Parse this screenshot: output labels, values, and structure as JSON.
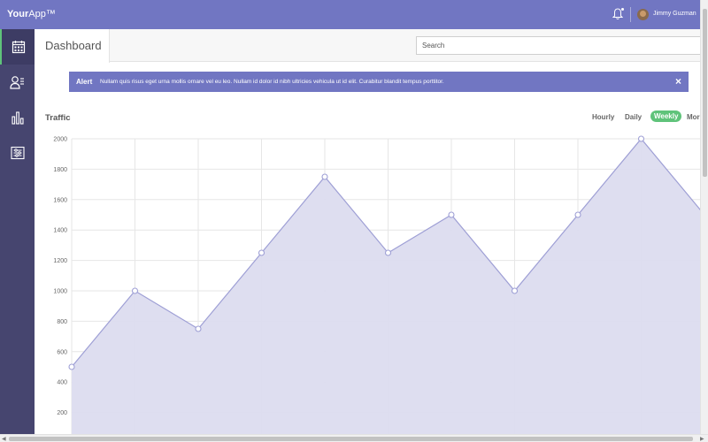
{
  "header": {
    "logo_bold": "Your",
    "logo_light": "App™",
    "username": "Jimmy Guzman"
  },
  "sidebar": {
    "items": [
      {
        "icon": "calendar-icon",
        "active": true
      },
      {
        "icon": "users-list-icon",
        "active": false
      },
      {
        "icon": "bar-chart-icon",
        "active": false
      },
      {
        "icon": "settings-sliders-icon",
        "active": false
      }
    ]
  },
  "main": {
    "tab_label": "Dashboard",
    "search_placeholder": "Search",
    "alert": {
      "title": "Alert",
      "text": "Nullam quis risus eget urna mollis ornare vel eu leo. Nullam id dolor id nibh ultricies vehicula ut id elit. Curabitur blandit tempus porttitor.",
      "close": "×"
    },
    "traffic": {
      "title": "Traffic",
      "ranges": [
        "Hourly",
        "Daily",
        "Weekly",
        "Mor"
      ],
      "active_range": "Weekly"
    }
  },
  "colors": {
    "accent": "#7176c2",
    "sidebar": "#46456f",
    "active_green": "#5fc37a",
    "chart_fill": "#dcdcef",
    "chart_line": "#9e9fd5"
  },
  "chart_data": {
    "type": "area",
    "title": "Traffic",
    "xlabel": "",
    "ylabel": "",
    "ylim": [
      0,
      2000
    ],
    "yticks": [
      200,
      400,
      600,
      800,
      1000,
      1200,
      1400,
      1600,
      1800,
      2000
    ],
    "series": [
      {
        "values": [
          500,
          1000,
          750,
          1250,
          1750,
          1250,
          1500,
          1000,
          1500,
          2000,
          1500
        ]
      }
    ],
    "grid": true,
    "legend": "none"
  }
}
